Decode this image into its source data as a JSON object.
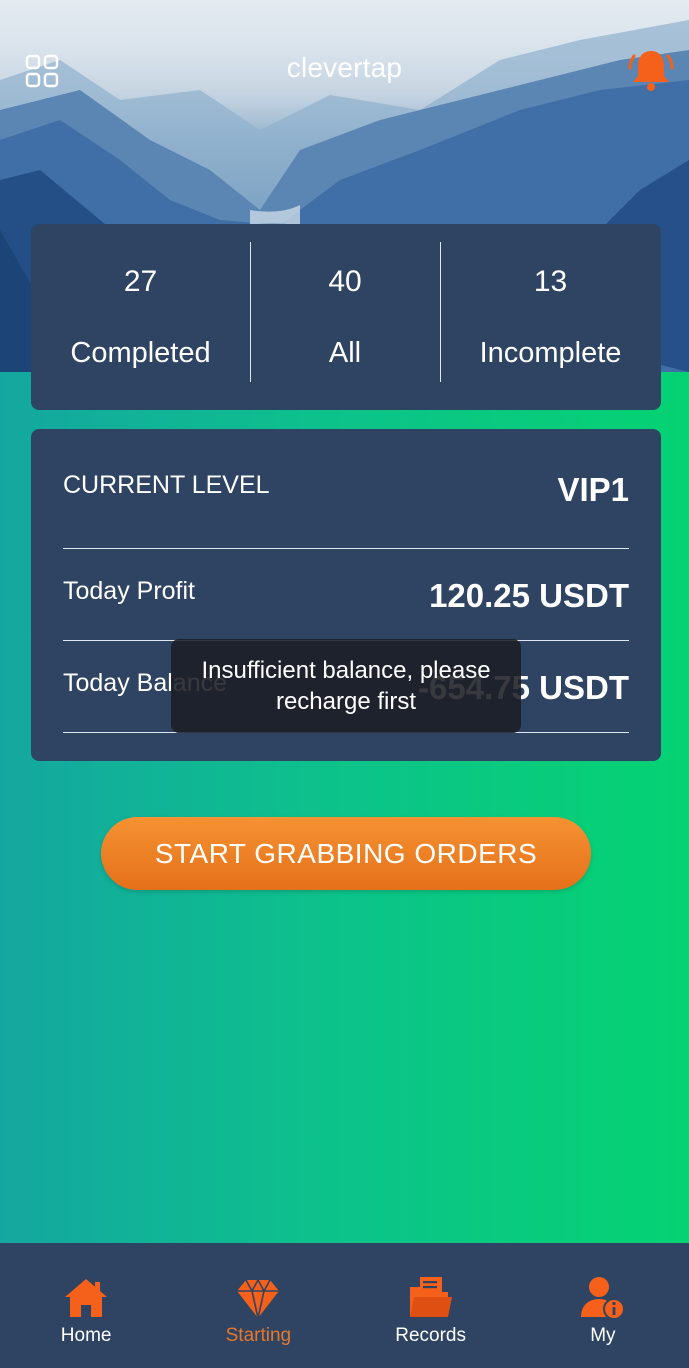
{
  "header": {
    "title": "clevertap",
    "menu_icon": "grid-menu-icon",
    "bell_icon": "bell-icon"
  },
  "stats": [
    {
      "value": "27",
      "label": "Completed"
    },
    {
      "value": "40",
      "label": "All"
    },
    {
      "value": "13",
      "label": "Incomplete"
    }
  ],
  "level": {
    "current_level_label": "CURRENT LEVEL",
    "current_level_value": "VIP1",
    "today_profit_label": "Today Profit",
    "today_profit_value": "120.25 USDT",
    "today_balance_label": "Today Balance",
    "today_balance_value": "-654.75 USDT"
  },
  "toast": {
    "message": "Insufficient balance, please recharge first"
  },
  "cta": {
    "label": "START GRABBING ORDERS"
  },
  "nav": [
    {
      "label": "Home",
      "icon": "home-icon",
      "active": false
    },
    {
      "label": "Starting",
      "icon": "diamond-icon",
      "active": true
    },
    {
      "label": "Records",
      "icon": "folder-icon",
      "active": false
    },
    {
      "label": "My",
      "icon": "user-info-icon",
      "active": false
    }
  ],
  "colors": {
    "card_bg": "#2e4462",
    "accent_orange": "#f5601a",
    "active_label": "#e8772a",
    "bg_gradient_start": "#14a7a0",
    "bg_gradient_end": "#05d272"
  }
}
